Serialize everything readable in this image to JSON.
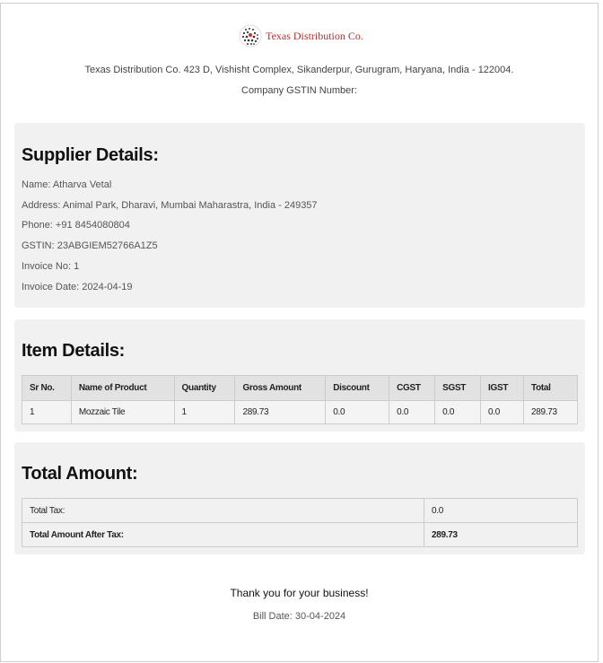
{
  "header": {
    "logo_icon": "globe-dots-icon",
    "company_name": "Texas Distribution Co.",
    "address_line": "Texas Distribution Co. 423 D, Vishisht Complex, Sikanderpur, Gurugram, Haryana, India - 122004.",
    "gstin_line": "Company GSTIN Number:",
    "brand_color": "#c0282a"
  },
  "supplier": {
    "title": "Supplier Details:",
    "lines": [
      "Name: Atharva Vetal",
      "Address: Animal Park, Dharavi, Mumbai Maharastra, India - 249357",
      "Phone: +91 8454080804",
      "GSTIN: 23ABGIEM52766A1Z5",
      "Invoice No: 1",
      "Invoice Date: 2024-04-19"
    ]
  },
  "items": {
    "title": "Item Details:",
    "columns": [
      "Sr No.",
      "Name of Product",
      "Quantity",
      "Gross Amount",
      "Discount",
      "CGST",
      "SGST",
      "IGST",
      "Total"
    ],
    "rows": [
      [
        "1",
        "Mozzaic Tile",
        "1",
        "289.73",
        "0.0",
        "0.0",
        "0.0",
        "0.0",
        "289.73"
      ]
    ]
  },
  "totals": {
    "title": "Total Amount:",
    "rows": [
      {
        "label": "Total Tax:",
        "value": "0.0"
      },
      {
        "label": "Total Amount After Tax:",
        "value": "289.73"
      }
    ]
  },
  "footer": {
    "thanks": "Thank you for your business!",
    "bill_date": "Bill Date: 30-04-2024"
  }
}
